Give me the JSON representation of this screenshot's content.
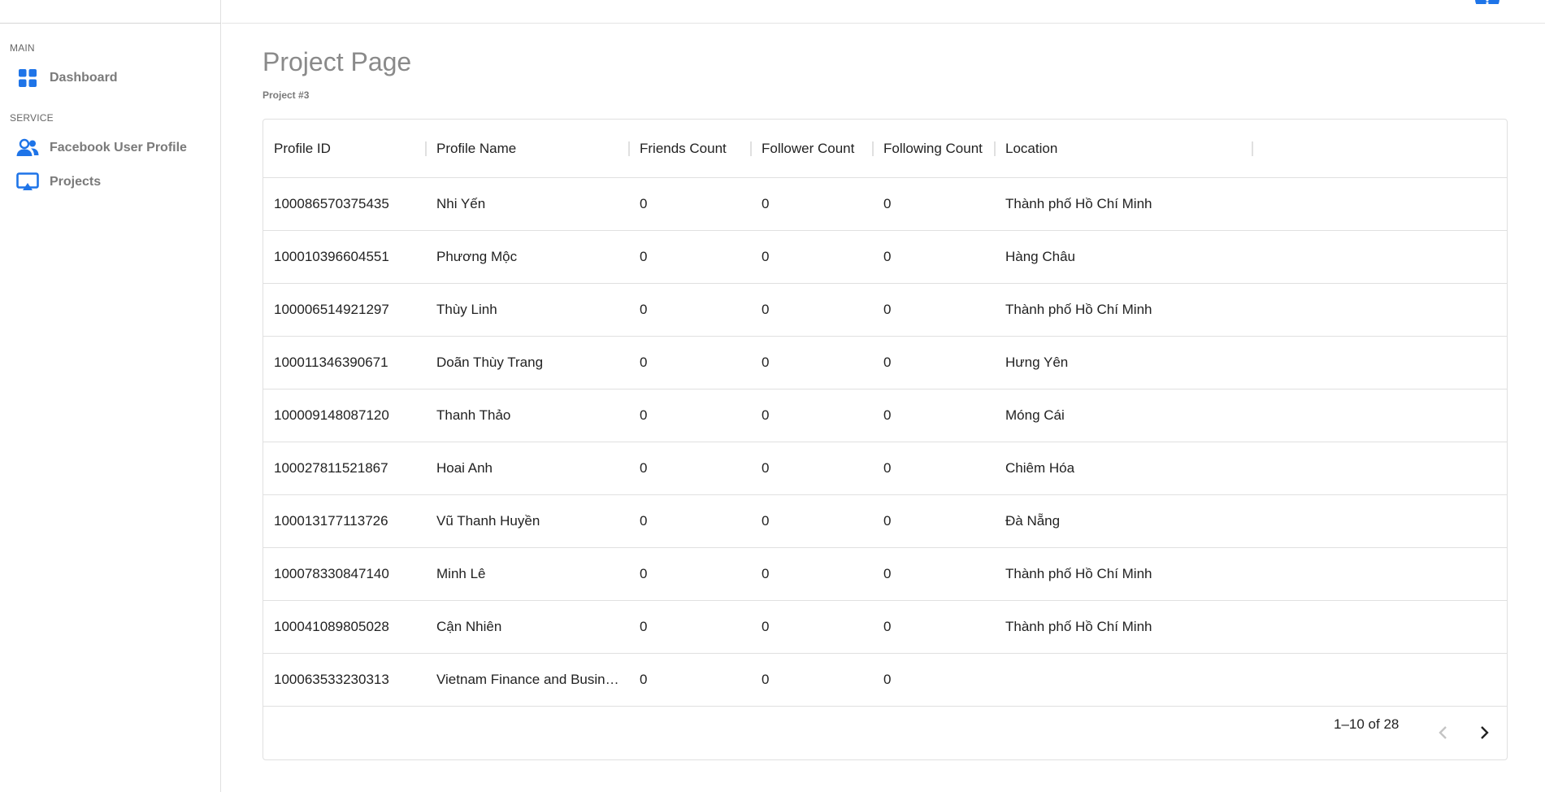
{
  "sidebar": {
    "sections": [
      {
        "label": "MAIN"
      },
      {
        "label": "SERVICE"
      }
    ],
    "items": [
      {
        "label": "Dashboard",
        "icon": "dashboard-grid-icon"
      },
      {
        "label": "Facebook User Profile",
        "icon": "users-icon"
      },
      {
        "label": "Projects",
        "icon": "monitor-icon"
      }
    ]
  },
  "header": {
    "avatar_icon": "account-circle-icon",
    "accent": "#1e74e8"
  },
  "page": {
    "title": "Project Page",
    "subtitle": "Project #3"
  },
  "table": {
    "columns": [
      "Profile ID",
      "Profile Name",
      "Friends Count",
      "Follower Count",
      "Following Count",
      "Location"
    ],
    "rows": [
      [
        "100086570375435",
        "Nhi Yến",
        "0",
        "0",
        "0",
        "Thành phố Hồ Chí Minh"
      ],
      [
        "100010396604551",
        "Phương Mộc",
        "0",
        "0",
        "0",
        "Hàng Châu"
      ],
      [
        "100006514921297",
        "Thùy Linh",
        "0",
        "0",
        "0",
        "Thành phố Hồ Chí Minh"
      ],
      [
        "100011346390671",
        "Doãn Thùy Trang",
        "0",
        "0",
        "0",
        "Hưng Yên"
      ],
      [
        "100009148087120",
        "Thanh Thảo",
        "0",
        "0",
        "0",
        "Móng Cái"
      ],
      [
        "100027811521867",
        "Hoai Anh",
        "0",
        "0",
        "0",
        "Chiêm Hóa"
      ],
      [
        "100013177113726",
        "Vũ Thanh Huyền",
        "0",
        "0",
        "0",
        "Đà Nẵng"
      ],
      [
        "100078330847140",
        "Minh Lê",
        "0",
        "0",
        "0",
        "Thành phố Hồ Chí Minh"
      ],
      [
        "100041089805028",
        "Cận Nhiên",
        "0",
        "0",
        "0",
        "Thành phố Hồ Chí Minh"
      ],
      [
        "100063533230313",
        "Vietnam Finance and Business",
        "0",
        "0",
        "0",
        ""
      ]
    ],
    "pagination": "1–10 of 28"
  }
}
